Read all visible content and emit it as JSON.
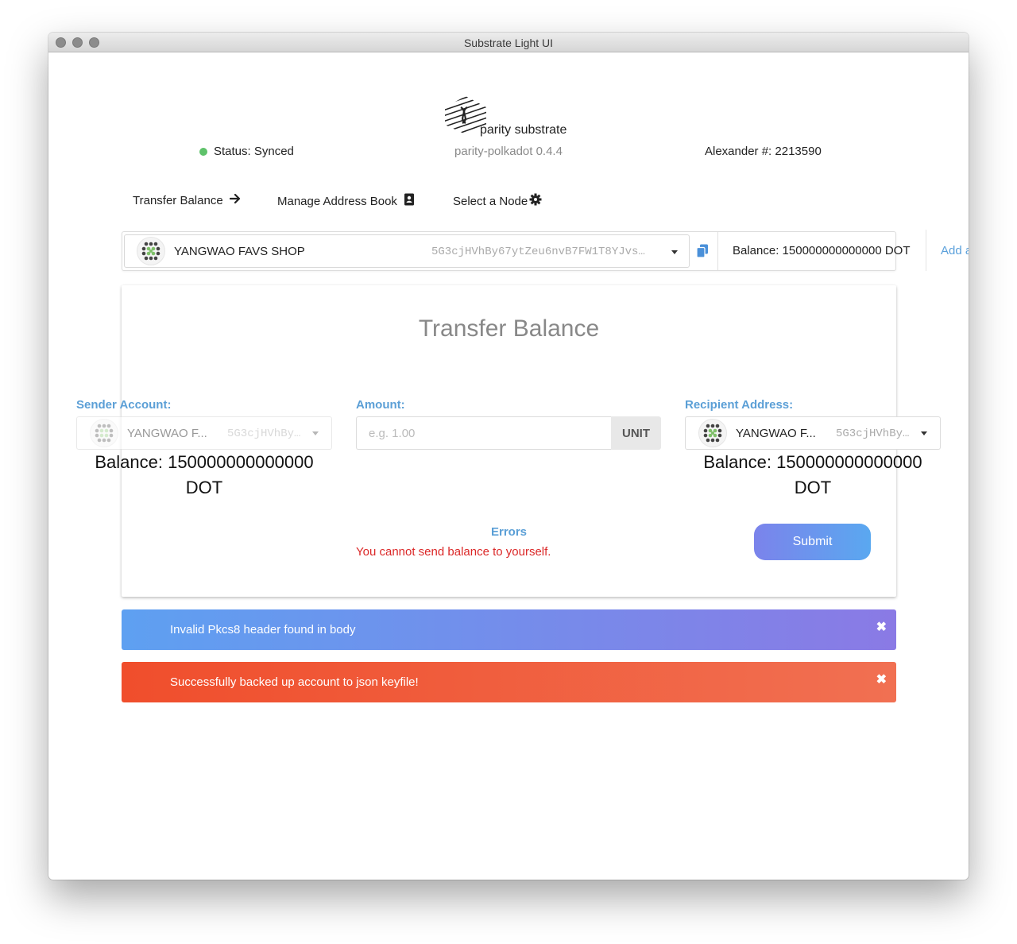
{
  "window": {
    "title": "Substrate Light UI"
  },
  "header": {
    "logo_text_bold": "parity",
    "logo_text": "substrate",
    "version": "parity-polkadot 0.4.4",
    "status": "Status: Synced",
    "block": "Alexander #: 2213590"
  },
  "nav": {
    "transfer": "Transfer Balance",
    "address_book": "Manage Address Book",
    "node": "Select a Node"
  },
  "account_bar": {
    "name": "YANGWAO FAVS SHOP",
    "address": "5G3cjHVhBy67ytZeu6nvB7FW1T8YJvs…",
    "balance": "Balance: 150000000000000 DOT",
    "add_link": "Add a"
  },
  "transfer": {
    "title": "Transfer Balance",
    "sender_label": "Sender Account:",
    "sender_name": "YANGWAO F...",
    "sender_addr": "5G3cjHVhBy…",
    "sender_balance_line1": "Balance: 150000000000000",
    "sender_balance_line2": "DOT",
    "amount_label": "Amount:",
    "amount_placeholder": "e.g. 1.00",
    "unit_label": "UNIT",
    "recipient_label": "Recipient Address:",
    "recipient_name": "YANGWAO F...",
    "recipient_addr": "5G3cjHVhBy…",
    "recipient_balance_line1": "Balance: 150000000000000",
    "recipient_balance_line2": "DOT",
    "errors_label": "Errors",
    "error_message": "You cannot send balance to yourself.",
    "submit_label": "Submit"
  },
  "notifications": [
    {
      "text": "Invalid Pkcs8 header found in body",
      "close": "✖",
      "type": "info"
    },
    {
      "text": "Successfully backed up account to json keyfile!",
      "close": "✖",
      "type": "error"
    }
  ],
  "colors": {
    "accent_blue": "#5b9fd6",
    "status_green": "#5ec26a",
    "error_red": "#db2828",
    "info_gradient": [
      "#5ea0f1",
      "#8a7ae5"
    ],
    "error_gradient": [
      "#f04e2c",
      "#f17052"
    ]
  },
  "icons": [
    "arrow-right-icon",
    "address-book-icon",
    "gear-icon",
    "copy-icon",
    "caret-down-icon",
    "identicon",
    "close-icon",
    "parity-logo"
  ]
}
